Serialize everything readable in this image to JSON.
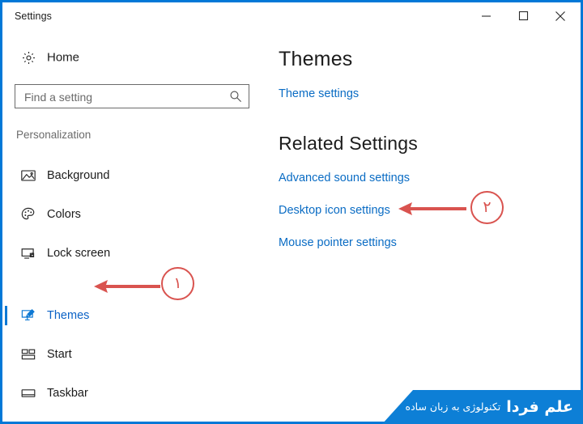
{
  "window": {
    "title": "Settings",
    "accent_color": "#0078d7",
    "controls": {
      "minimize": "Minimize",
      "maximize": "Maximize",
      "close": "Close"
    }
  },
  "sidebar": {
    "home": {
      "label": "Home",
      "icon": "gear-icon"
    },
    "search": {
      "value": "",
      "placeholder": "Find a setting",
      "icon": "search-icon"
    },
    "group_label": "Personalization",
    "items": [
      {
        "label": "Background",
        "icon": "picture-icon",
        "selected": false
      },
      {
        "label": "Colors",
        "icon": "palette-icon",
        "selected": false
      },
      {
        "label": "Lock screen",
        "icon": "lock-screen-icon",
        "selected": false
      },
      {
        "label": "Themes",
        "icon": "themes-brush-icon",
        "selected": true
      },
      {
        "label": "Start",
        "icon": "start-tiles-icon",
        "selected": false
      },
      {
        "label": "Taskbar",
        "icon": "taskbar-icon",
        "selected": false
      }
    ],
    "selected_color": "#0c63c6"
  },
  "content": {
    "page_title": "Themes",
    "theme_settings_link": "Theme settings",
    "related_title": "Related Settings",
    "related_links": [
      "Advanced sound settings",
      "Desktop icon settings",
      "Mouse pointer settings"
    ],
    "link_color": "#0a6cc4"
  },
  "annotations": {
    "color": "#d9534f",
    "markers": [
      {
        "number": "۱",
        "target": "Themes"
      },
      {
        "number": "۲",
        "target": "Desktop icon settings"
      }
    ]
  },
  "watermark": {
    "brand": "علم فردا",
    "tagline": "تکنولوژی به زبان ساده",
    "background": "#0d7fd6"
  }
}
